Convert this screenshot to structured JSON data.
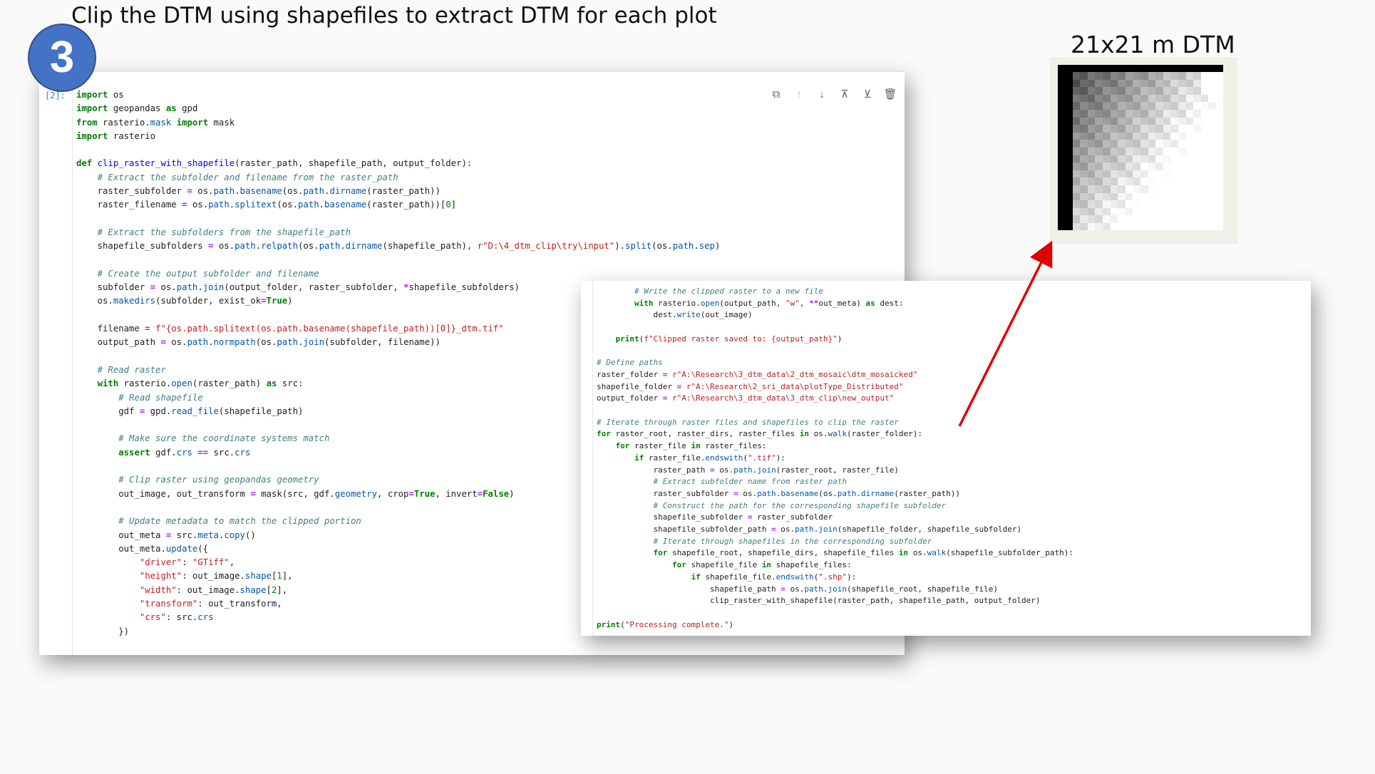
{
  "slide": {
    "title": "Clip the DTM using shapefiles to extract DTM for each plot",
    "step_number": "3"
  },
  "notebook": {
    "cell_prompt": "[2]:",
    "toolbar": [
      {
        "name": "duplicate-icon",
        "glyph": "⧉",
        "enabled": true
      },
      {
        "name": "move-up-icon",
        "glyph": "↑",
        "enabled": false
      },
      {
        "name": "move-down-icon",
        "glyph": "↓",
        "enabled": true
      },
      {
        "name": "insert-above-icon",
        "glyph": "⊼",
        "enabled": true
      },
      {
        "name": "insert-below-icon",
        "glyph": "⊻",
        "enabled": true
      },
      {
        "name": "delete-icon",
        "glyph": "🗑",
        "enabled": true
      }
    ],
    "code_part1": "import os\nimport geopandas as gpd\nfrom rasterio.mask import mask\nimport rasterio\n\ndef clip_raster_with_shapefile(raster_path, shapefile_path, output_folder):\n    # Extract the subfolder and filename from the raster_path\n    raster_subfolder = os.path.basename(os.path.dirname(raster_path))\n    raster_filename = os.path.splitext(os.path.basename(raster_path))[0]\n\n    # Extract the subfolders from the shapefile_path\n    shapefile_subfolders = os.path.relpath(os.path.dirname(shapefile_path), r\"D:\\4_dtm_clip\\try\\input\").split(os.path.sep)\n\n    # Create the output subfolder and filename\n    subfolder = os.path.join(output_folder, raster_subfolder, *shapefile_subfolders)\n    os.makedirs(subfolder, exist_ok=True)\n\n    filename = f\"{os.path.splitext(os.path.basename(shapefile_path))[0]}_dtm.tif\"\n    output_path = os.path.normpath(os.path.join(subfolder, filename))\n\n    # Read raster\n    with rasterio.open(raster_path) as src:\n        # Read shapefile\n        gdf = gpd.read_file(shapefile_path)\n\n        # Make sure the coordinate systems match\n        assert gdf.crs == src.crs\n\n        # Clip raster using geopandas geometry\n        out_image, out_transform = mask(src, gdf.geometry, crop=True, invert=False)\n\n        # Update metadata to match the clipped portion\n        out_meta = src.meta.copy()\n        out_meta.update({\n            \"driver\": \"GTiff\",\n            \"height\": out_image.shape[1],\n            \"width\": out_image.shape[2],\n            \"transform\": out_transform,\n            \"crs\": src.crs\n        })",
    "code_part2": "        # Write the clipped raster to a new file\n        with rasterio.open(output_path, \"w\", **out_meta) as dest:\n            dest.write(out_image)\n\n    print(f\"Clipped raster saved to: {output_path}\")\n\n# Define paths\nraster_folder = r\"A:\\Research\\3_dtm_data\\2_dtm_mosaic\\dtm_mosaicked\"\nshapefile_folder = r\"A:\\Research\\2_sri_data\\plotType_Distributed\"\noutput_folder = r\"A:\\Research\\3_dtm_data\\3_dtm_clip\\new_output\"\n\n# Iterate through raster files and shapefiles to clip the raster\nfor raster_root, raster_dirs, raster_files in os.walk(raster_folder):\n    for raster_file in raster_files:\n        if raster_file.endswith(\".tif\"):\n            raster_path = os.path.join(raster_root, raster_file)\n            # Extract subfolder name from raster path\n            raster_subfolder = os.path.basename(os.path.dirname(raster_path))\n            # Construct the path for the corresponding shapefile subfolder\n            shapefile_subfolder = raster_subfolder\n            shapefile_subfolder_path = os.path.join(shapefile_folder, shapefile_subfolder)\n            # Iterate through shapefiles in the corresponding subfolder\n            for shapefile_root, shapefile_dirs, shapefile_files in os.walk(shapefile_subfolder_path):\n                for shapefile_file in shapefile_files:\n                    if shapefile_file.endswith(\".shp\"):\n                        shapefile_path = os.path.join(shapefile_root, shapefile_file)\n                        clip_raster_with_shapefile(raster_path, shapefile_path, output_folder)\n\nprint(\"Processing complete.\")"
  },
  "result": {
    "caption": "21x21 m DTM",
    "grid_size": 21
  },
  "colors": {
    "badge": "#4472c4",
    "arrow": "#e00000"
  }
}
